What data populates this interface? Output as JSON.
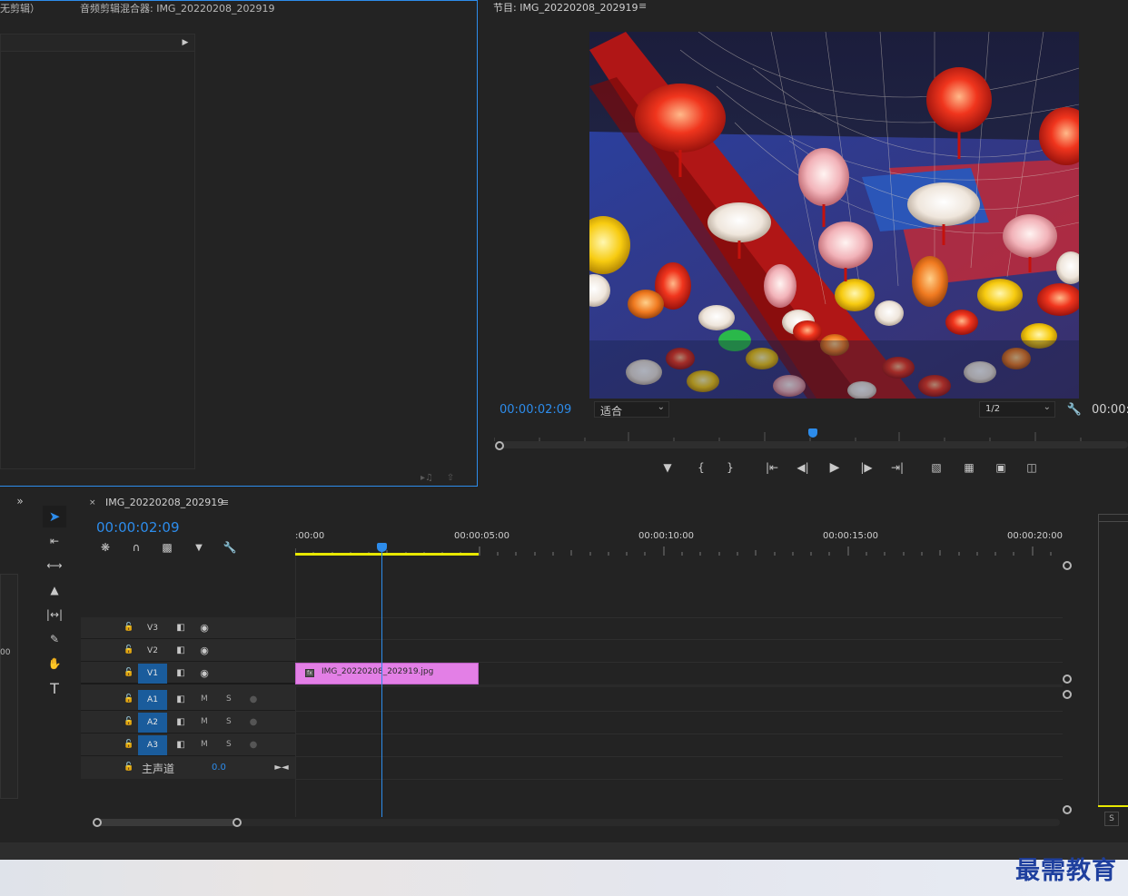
{
  "source_panel": {
    "tab_no_clip": "无剪辑）",
    "tab_audio_mixer": "音频剪辑混合器: IMG_20220208_202919"
  },
  "program_monitor": {
    "title": "节目: IMG_20220208_202919",
    "timecode": "00:00:02:09",
    "fit_label": "适合",
    "resolution_label": "1/2",
    "end_timecode": "00:00:",
    "preview_image": "lantern-festival-photo"
  },
  "sequence": {
    "tab_name": "IMG_20220208_202919",
    "timecode": "00:00:02:09",
    "ruler_labels": [
      ":00:00",
      "00:00:05:00",
      "00:00:10:00",
      "00:00:15:00",
      "00:00:20:00"
    ],
    "video_tracks": [
      {
        "name": "V3",
        "active": false
      },
      {
        "name": "V2",
        "active": false
      },
      {
        "name": "V1",
        "active": true
      }
    ],
    "audio_tracks": [
      {
        "name": "A1",
        "m": "M",
        "s": "S"
      },
      {
        "name": "A2",
        "m": "M",
        "s": "S"
      },
      {
        "name": "A3",
        "m": "M",
        "s": "S"
      }
    ],
    "master": {
      "label": "主声道",
      "value": "0.0"
    },
    "clip": {
      "name": "IMG_20220208_202919.jpg",
      "color": "#e37fe6"
    }
  },
  "left_edge": {
    "value": "00"
  },
  "meter": {
    "s_label": "S"
  },
  "watermark": {
    "text": "最需教育"
  },
  "colors": {
    "accent": "#2d8ceb",
    "clip": "#e37fe6",
    "work_area": "#e8e800",
    "panel_border": "#2d8ceb"
  }
}
